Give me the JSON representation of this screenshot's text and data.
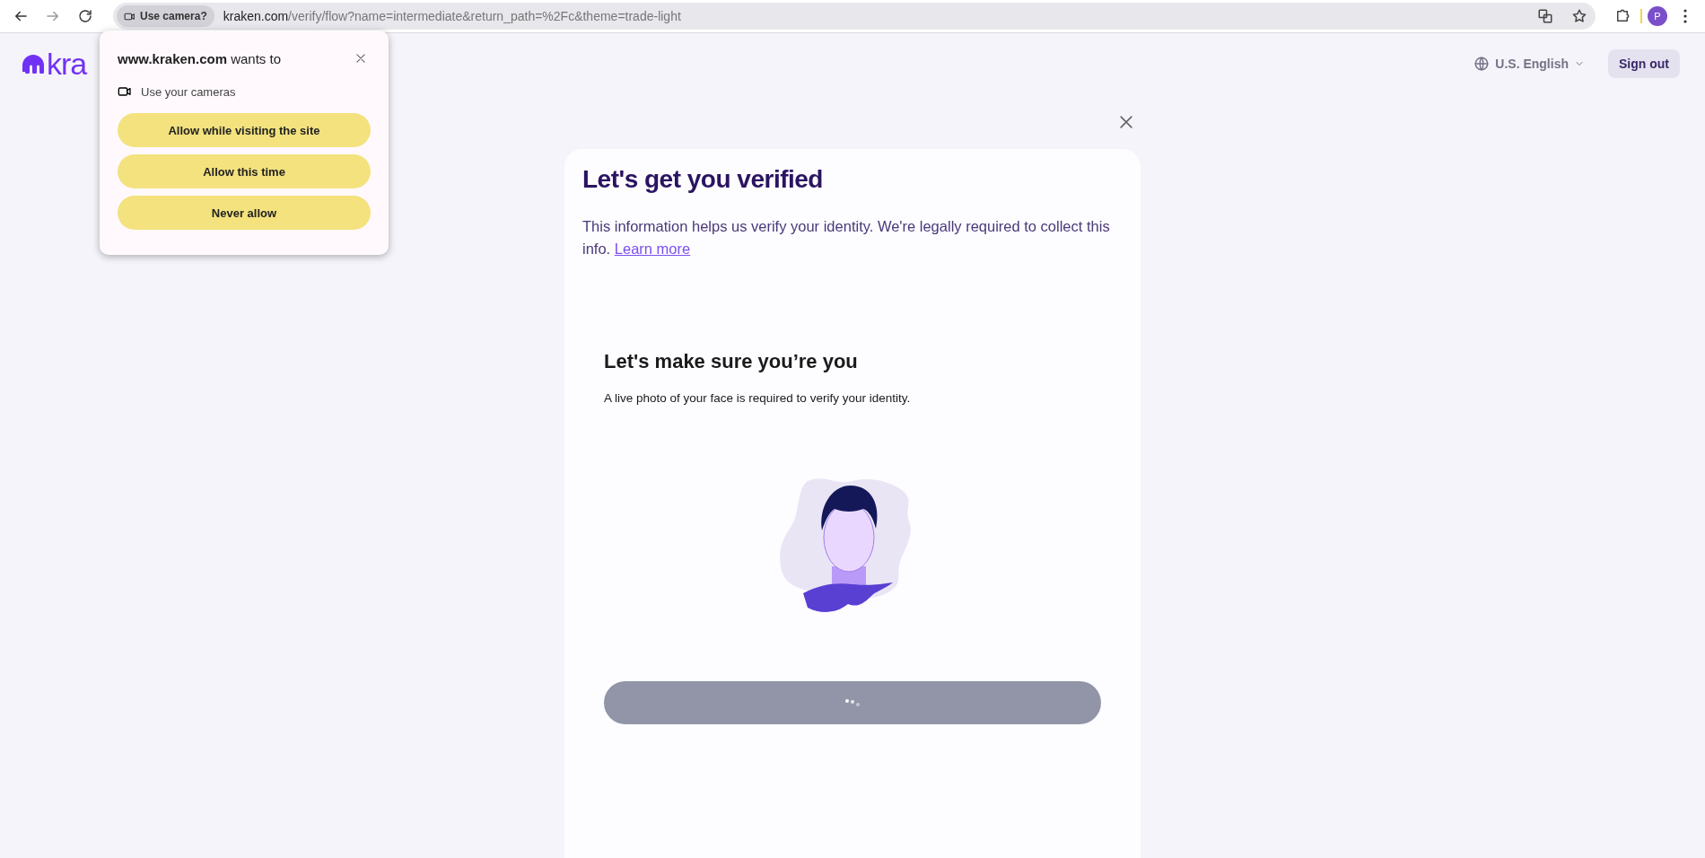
{
  "browser": {
    "permission_chip": "Use camera?",
    "url_host": "kraken.com",
    "url_path": "/verify/flow?name=intermediate&return_path=%2Fc&theme=trade-light",
    "profile_initial": "P"
  },
  "permission_popup": {
    "title": "**www.kraken.com** wants to",
    "permission": "Use your cameras",
    "buttons": [
      "Allow while visiting the site",
      "Allow this time",
      "Never allow"
    ]
  },
  "header": {
    "logo": "kra",
    "language": "U.S. English",
    "sign_out": "Sign out"
  },
  "card": {
    "title": "Let's get you verified",
    "body": "This information helps us verify your identity. We're legally required to collect this info.",
    "link": "Learn more",
    "section_title": "Let's make sure you’re you",
    "section_text": "A live photo of your face is required to verify your identity.",
    "button": {
      "loading": true
    }
  }
}
